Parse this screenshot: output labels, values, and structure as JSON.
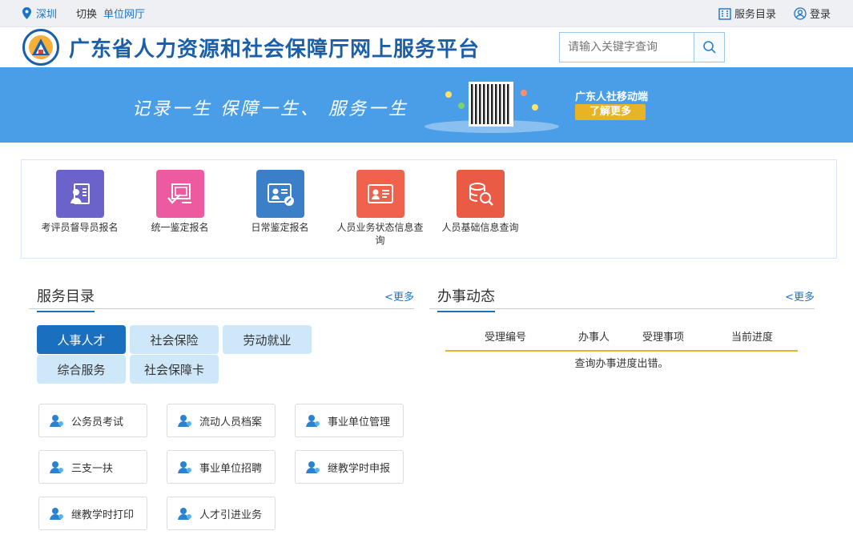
{
  "topbar": {
    "city": "深圳",
    "switch_label": "切换",
    "unit_link": "单位网厅",
    "service_catalog": "服务目录",
    "login": "登录"
  },
  "header": {
    "title": "广东省人力资源和社会保障厅网上服务平台",
    "search_placeholder": "请输入关键字查询"
  },
  "banner": {
    "slogan": "记录一生  保障一生、 服务一生",
    "mobile_label": "广东人社移动端",
    "more_button": "了解更多"
  },
  "services": [
    {
      "label": "考评员督导员报名",
      "color": "#6b63c9",
      "icon": "id-badge-icon"
    },
    {
      "label": "统一鉴定报名",
      "color": "#ee5aa0",
      "icon": "certificate-check-icon"
    },
    {
      "label": "日常鉴定报名",
      "color": "#3b7fc8",
      "icon": "id-card-edit-icon"
    },
    {
      "label": "人员业务状态信息查询",
      "color": "#f0614e",
      "icon": "id-card-icon"
    },
    {
      "label": "人员基础信息查询",
      "color": "#ea5b45",
      "icon": "database-search-icon"
    }
  ],
  "service_catalog": {
    "title": "服务目录",
    "more": "<更多",
    "tabs": [
      "人事人才",
      "社会保险",
      "劳动就业",
      "综合服务",
      "社会保障卡"
    ],
    "active_tab": "人事人才",
    "items": [
      "公务员考试",
      "流动人员档案",
      "事业单位管理",
      "三支一扶",
      "事业单位招聘",
      "继教学时申报",
      "继教学时打印",
      "人才引进业务"
    ]
  },
  "progress": {
    "title": "办事动态",
    "more": "<更多",
    "columns": [
      "受理编号",
      "办事人",
      "受理事项",
      "当前进度"
    ],
    "message": "查询办事进度出错。"
  },
  "colors": {
    "brand_blue": "#1b5fa8",
    "banner_blue": "#4a9ee8",
    "tab_active": "#1a6fbf",
    "tab_inactive": "#cfe8f9",
    "accent_gold": "#e3b32c"
  }
}
